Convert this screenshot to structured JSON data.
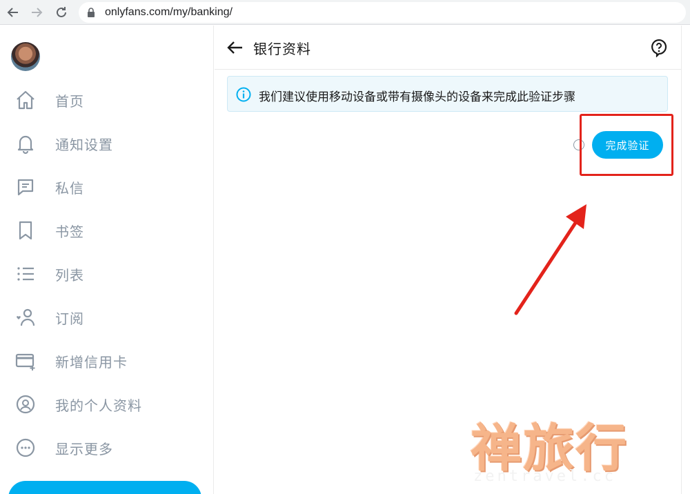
{
  "browser": {
    "url": "onlyfans.com/my/banking/"
  },
  "sidebar": {
    "items": [
      {
        "label": "首页",
        "icon": "home-icon"
      },
      {
        "label": "通知设置",
        "icon": "bell-icon"
      },
      {
        "label": "私信",
        "icon": "message-icon"
      },
      {
        "label": "书签",
        "icon": "bookmark-icon"
      },
      {
        "label": "列表",
        "icon": "list-icon"
      },
      {
        "label": "订阅",
        "icon": "subscriptions-icon"
      },
      {
        "label": "新增信用卡",
        "icon": "add-card-icon"
      },
      {
        "label": "我的个人资料",
        "icon": "profile-icon"
      },
      {
        "label": "显示更多",
        "icon": "more-icon"
      }
    ]
  },
  "main": {
    "title": "银行资料",
    "info_text": "我们建议使用移动设备或带有摄像头的设备来完成此验证步骤",
    "verify_button": "完成验证"
  },
  "watermark": {
    "text": "禅旅行",
    "url": "zentravel.cc"
  },
  "colors": {
    "accent": "#00aff0",
    "highlight": "#e3231b",
    "muted": "#8a96a3"
  }
}
